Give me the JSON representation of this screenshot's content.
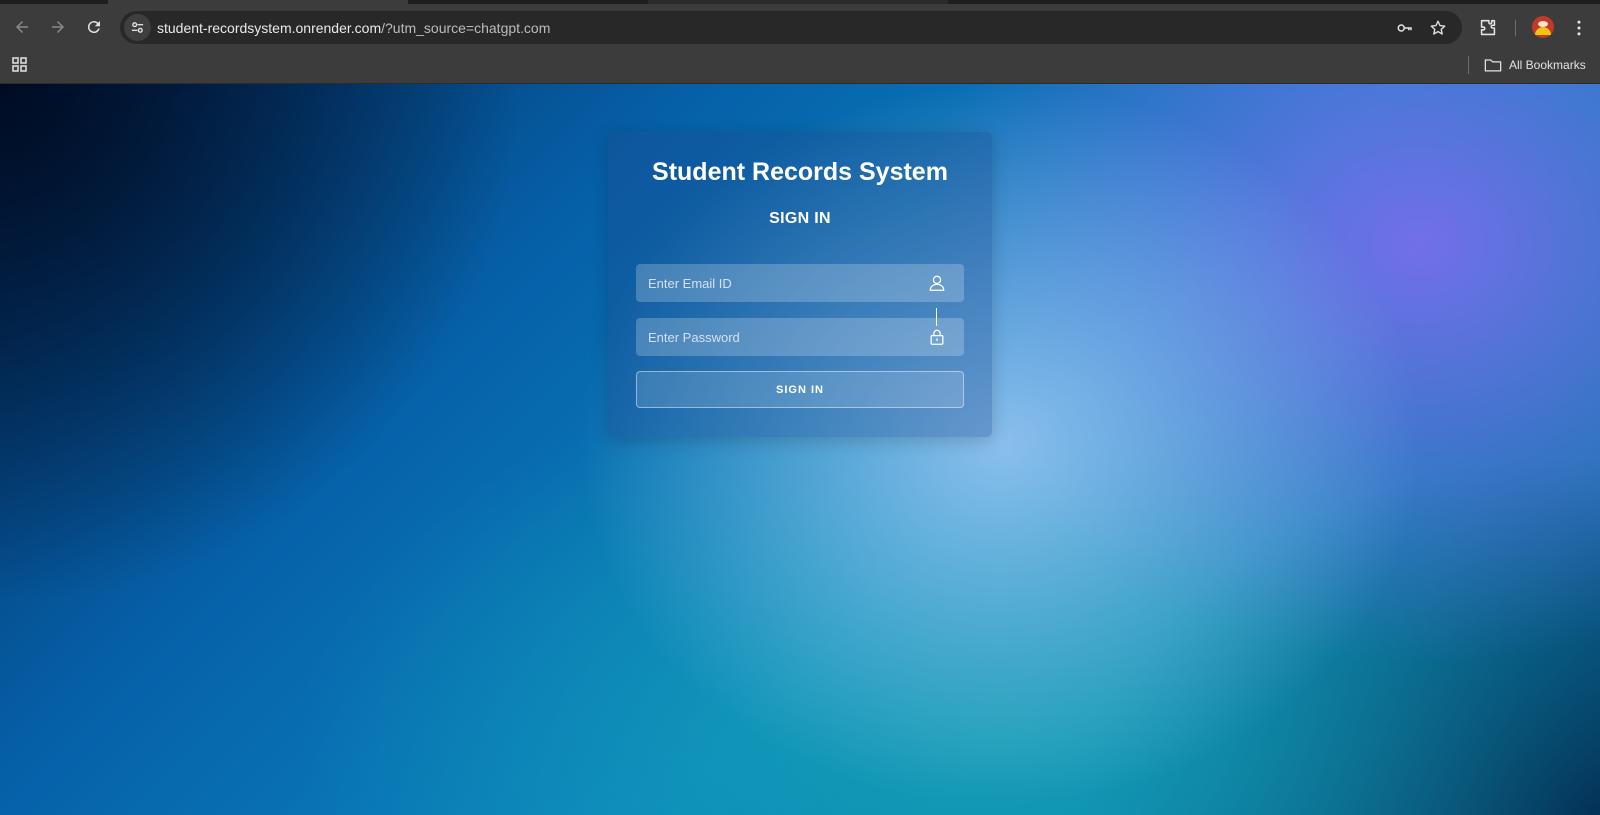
{
  "browser": {
    "url_host": "student-recordsystem.onrender.com",
    "url_path": "/?utm_source=chatgpt.com",
    "bookmarks_label": "All Bookmarks",
    "icons": {
      "back": "arrow-left-icon",
      "forward": "arrow-right-icon",
      "reload": "reload-icon",
      "site_info": "tune-icon",
      "password": "key-icon",
      "bookmark": "star-icon",
      "extensions": "puzzle-icon",
      "menu": "kebab-menu-icon",
      "apps": "grid-icon",
      "folder": "folder-icon"
    }
  },
  "login": {
    "title": "Student Records System",
    "heading": "SIGN IN",
    "email_placeholder": "Enter Email ID",
    "password_placeholder": "Enter Password",
    "button_label": "SIGN IN"
  },
  "colors": {
    "chrome_bg": "#3c3c3c",
    "omnibox_bg": "#282828",
    "text_white": "#ffffff"
  }
}
